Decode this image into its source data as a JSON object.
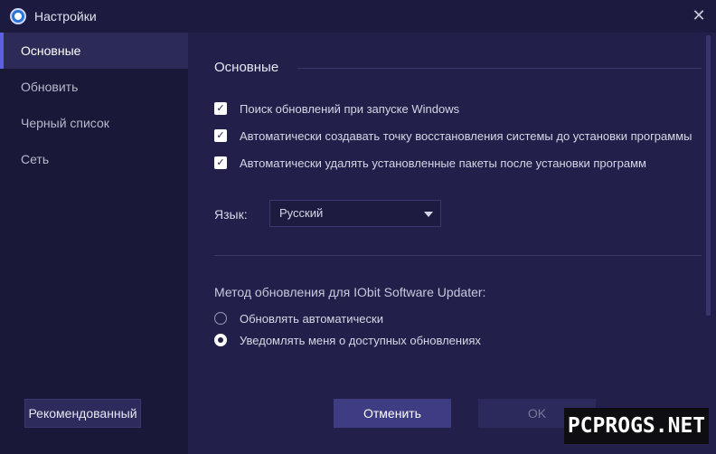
{
  "window": {
    "title": "Настройки",
    "icon": "iobit-updater-icon",
    "close_glyph": "✕"
  },
  "sidebar": {
    "items": [
      {
        "label": "Основные",
        "active": true
      },
      {
        "label": "Обновить",
        "active": false
      },
      {
        "label": "Черный список",
        "active": false
      },
      {
        "label": "Сеть",
        "active": false
      }
    ],
    "recommend_label": "Рекомендованный"
  },
  "main": {
    "section_title": "Основные",
    "checkboxes": [
      {
        "label": "Поиск обновлений при запуске Windows",
        "checked": true
      },
      {
        "label": "Автоматически создавать точку восстановления системы до установки программы",
        "checked": true
      },
      {
        "label": "Автоматически удалять установленные пакеты после установки программ",
        "checked": true
      }
    ],
    "check_glyph": "✓",
    "language": {
      "label": "Язык:",
      "value": "Русский"
    },
    "update_method": {
      "label": "Метод обновления для IObit Software Updater:",
      "options": [
        {
          "label": "Обновлять автоматически",
          "selected": false
        },
        {
          "label": "Уведомлять меня о доступных обновлениях",
          "selected": true
        }
      ]
    },
    "cancel_label": "Отменить",
    "ok_label": "OK"
  },
  "watermark": "PCPROGS.NET",
  "colors": {
    "background": "#22204a",
    "sidebar": "#1a1838",
    "active_item": "#2c2a56",
    "accent": "#5b5fe0",
    "cancel_button": "#3e3c82"
  }
}
